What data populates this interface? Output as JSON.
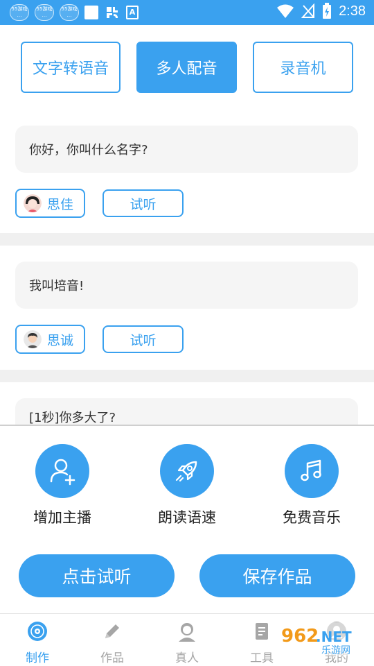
{
  "status_bar": {
    "time": "2:38",
    "app_badge_text": "55游戏"
  },
  "mode_tabs": [
    {
      "label": "文字转语音",
      "active": false
    },
    {
      "label": "多人配音",
      "active": true
    },
    {
      "label": "录音机",
      "active": false
    }
  ],
  "dialogues": [
    {
      "text": "你好，你叫什么名字?",
      "speaker": "思佳",
      "listen_label": "试听"
    },
    {
      "text": "我叫培音!",
      "speaker": "思诚",
      "listen_label": "试听"
    },
    {
      "text": "[1秒]你多大了?"
    }
  ],
  "tools": [
    {
      "label": "增加主播",
      "icon": "add-user-icon"
    },
    {
      "label": "朗读语速",
      "icon": "rocket-icon"
    },
    {
      "label": "免费音乐",
      "icon": "music-note-icon"
    }
  ],
  "actions": {
    "preview": "点击试听",
    "save": "保存作品"
  },
  "bottom_nav": [
    {
      "label": "制作",
      "icon": "disc-icon",
      "active": true
    },
    {
      "label": "作品",
      "icon": "pencil-icon",
      "active": false
    },
    {
      "label": "真人",
      "icon": "person-icon",
      "active": false
    },
    {
      "label": "工具",
      "icon": "document-icon",
      "active": false
    },
    {
      "label": "我的",
      "icon": "profile-icon",
      "active": false
    }
  ],
  "watermark": {
    "number": "962",
    "suffix": ".NET",
    "tagline": "乐游网"
  },
  "colors": {
    "accent": "#3aa1ef",
    "card_bg": "#f5f5f5",
    "inactive": "#a6a6a6"
  }
}
